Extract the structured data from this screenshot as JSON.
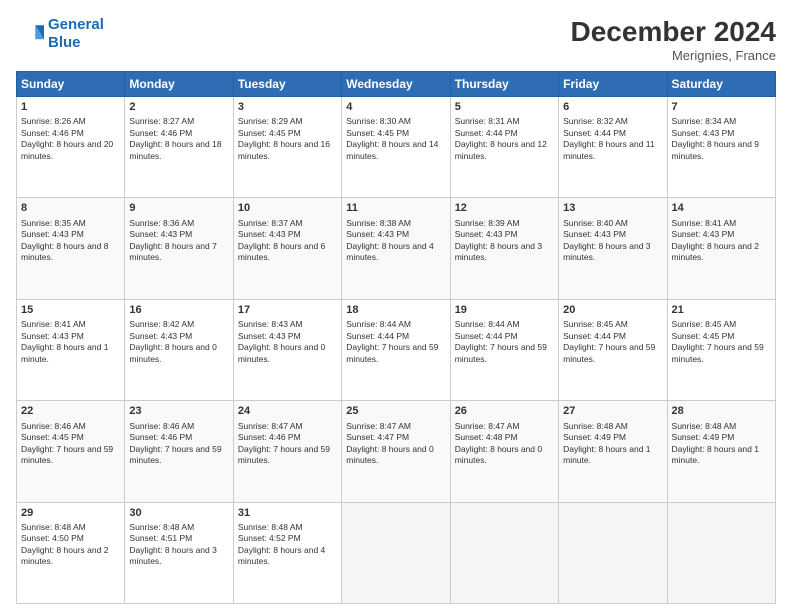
{
  "header": {
    "logo_line1": "General",
    "logo_line2": "Blue",
    "month": "December 2024",
    "location": "Merignies, France"
  },
  "days_of_week": [
    "Sunday",
    "Monday",
    "Tuesday",
    "Wednesday",
    "Thursday",
    "Friday",
    "Saturday"
  ],
  "weeks": [
    [
      {
        "day": 1,
        "sunrise": "8:26 AM",
        "sunset": "4:46 PM",
        "daylight": "8 hours and 20 minutes."
      },
      {
        "day": 2,
        "sunrise": "8:27 AM",
        "sunset": "4:46 PM",
        "daylight": "8 hours and 18 minutes."
      },
      {
        "day": 3,
        "sunrise": "8:29 AM",
        "sunset": "4:45 PM",
        "daylight": "8 hours and 16 minutes."
      },
      {
        "day": 4,
        "sunrise": "8:30 AM",
        "sunset": "4:45 PM",
        "daylight": "8 hours and 14 minutes."
      },
      {
        "day": 5,
        "sunrise": "8:31 AM",
        "sunset": "4:44 PM",
        "daylight": "8 hours and 12 minutes."
      },
      {
        "day": 6,
        "sunrise": "8:32 AM",
        "sunset": "4:44 PM",
        "daylight": "8 hours and 11 minutes."
      },
      {
        "day": 7,
        "sunrise": "8:34 AM",
        "sunset": "4:43 PM",
        "daylight": "8 hours and 9 minutes."
      }
    ],
    [
      {
        "day": 8,
        "sunrise": "8:35 AM",
        "sunset": "4:43 PM",
        "daylight": "8 hours and 8 minutes."
      },
      {
        "day": 9,
        "sunrise": "8:36 AM",
        "sunset": "4:43 PM",
        "daylight": "8 hours and 7 minutes."
      },
      {
        "day": 10,
        "sunrise": "8:37 AM",
        "sunset": "4:43 PM",
        "daylight": "8 hours and 6 minutes."
      },
      {
        "day": 11,
        "sunrise": "8:38 AM",
        "sunset": "4:43 PM",
        "daylight": "8 hours and 4 minutes."
      },
      {
        "day": 12,
        "sunrise": "8:39 AM",
        "sunset": "4:43 PM",
        "daylight": "8 hours and 3 minutes."
      },
      {
        "day": 13,
        "sunrise": "8:40 AM",
        "sunset": "4:43 PM",
        "daylight": "8 hours and 3 minutes."
      },
      {
        "day": 14,
        "sunrise": "8:41 AM",
        "sunset": "4:43 PM",
        "daylight": "8 hours and 2 minutes."
      }
    ],
    [
      {
        "day": 15,
        "sunrise": "8:41 AM",
        "sunset": "4:43 PM",
        "daylight": "8 hours and 1 minute."
      },
      {
        "day": 16,
        "sunrise": "8:42 AM",
        "sunset": "4:43 PM",
        "daylight": "8 hours and 0 minutes."
      },
      {
        "day": 17,
        "sunrise": "8:43 AM",
        "sunset": "4:43 PM",
        "daylight": "8 hours and 0 minutes."
      },
      {
        "day": 18,
        "sunrise": "8:44 AM",
        "sunset": "4:44 PM",
        "daylight": "7 hours and 59 minutes."
      },
      {
        "day": 19,
        "sunrise": "8:44 AM",
        "sunset": "4:44 PM",
        "daylight": "7 hours and 59 minutes."
      },
      {
        "day": 20,
        "sunrise": "8:45 AM",
        "sunset": "4:44 PM",
        "daylight": "7 hours and 59 minutes."
      },
      {
        "day": 21,
        "sunrise": "8:45 AM",
        "sunset": "4:45 PM",
        "daylight": "7 hours and 59 minutes."
      }
    ],
    [
      {
        "day": 22,
        "sunrise": "8:46 AM",
        "sunset": "4:45 PM",
        "daylight": "7 hours and 59 minutes."
      },
      {
        "day": 23,
        "sunrise": "8:46 AM",
        "sunset": "4:46 PM",
        "daylight": "7 hours and 59 minutes."
      },
      {
        "day": 24,
        "sunrise": "8:47 AM",
        "sunset": "4:46 PM",
        "daylight": "7 hours and 59 minutes."
      },
      {
        "day": 25,
        "sunrise": "8:47 AM",
        "sunset": "4:47 PM",
        "daylight": "8 hours and 0 minutes."
      },
      {
        "day": 26,
        "sunrise": "8:47 AM",
        "sunset": "4:48 PM",
        "daylight": "8 hours and 0 minutes."
      },
      {
        "day": 27,
        "sunrise": "8:48 AM",
        "sunset": "4:49 PM",
        "daylight": "8 hours and 1 minute."
      },
      {
        "day": 28,
        "sunrise": "8:48 AM",
        "sunset": "4:49 PM",
        "daylight": "8 hours and 1 minute."
      }
    ],
    [
      {
        "day": 29,
        "sunrise": "8:48 AM",
        "sunset": "4:50 PM",
        "daylight": "8 hours and 2 minutes."
      },
      {
        "day": 30,
        "sunrise": "8:48 AM",
        "sunset": "4:51 PM",
        "daylight": "8 hours and 3 minutes."
      },
      {
        "day": 31,
        "sunrise": "8:48 AM",
        "sunset": "4:52 PM",
        "daylight": "8 hours and 4 minutes."
      },
      null,
      null,
      null,
      null
    ]
  ]
}
